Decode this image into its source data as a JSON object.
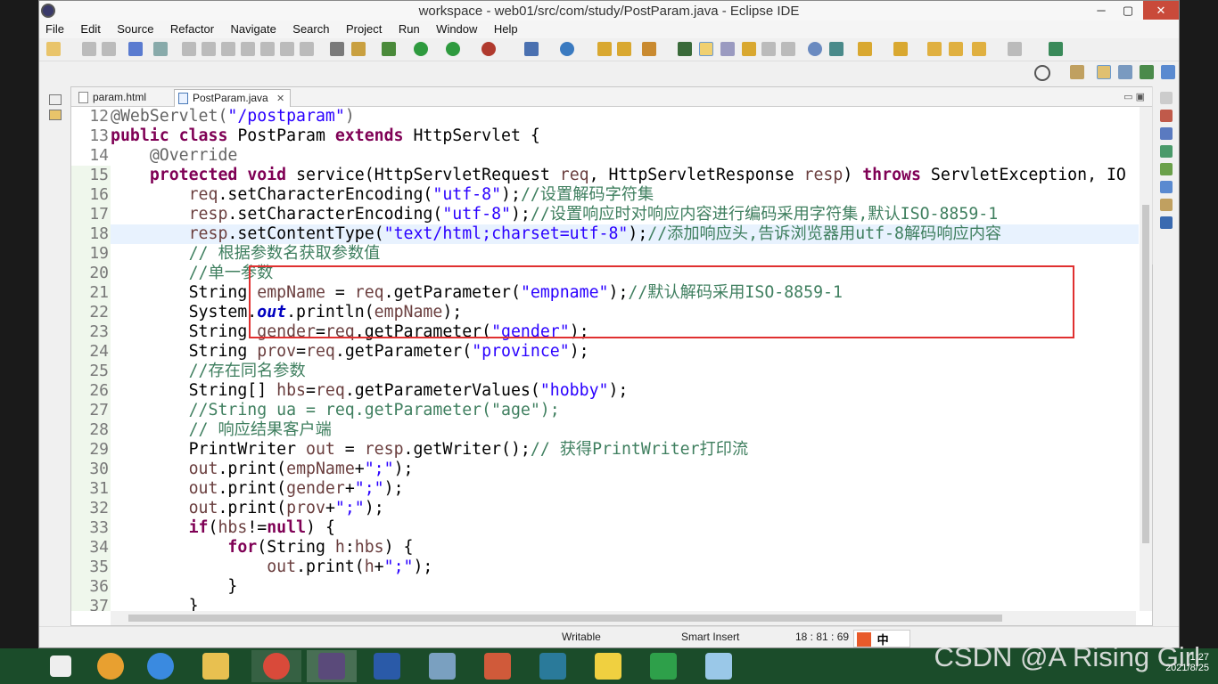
{
  "window": {
    "title": "workspace - web01/src/com/study/PostParam.java - Eclipse IDE",
    "minimize": "─",
    "maximize": "▢",
    "close": "✕"
  },
  "menu": [
    "File",
    "Edit",
    "Source",
    "Refactor",
    "Navigate",
    "Search",
    "Project",
    "Run",
    "Window",
    "Help"
  ],
  "tabs": [
    {
      "label": "param.html",
      "icon": "html-file-icon"
    },
    {
      "label": "PostParam.java",
      "icon": "java-file-icon",
      "active": true,
      "close": "✕"
    }
  ],
  "code_lines": [
    {
      "num": "12",
      "html": "<span class=\"ann\">@WebServlet(</span><span class=\"str\">\"/postparam\"</span><span class=\"ann\">)</span>"
    },
    {
      "num": "13",
      "html": "<span class=\"kw\">public</span> <span class=\"kw\">class</span> PostParam <span class=\"kw\">extends</span> HttpServlet {"
    },
    {
      "num": "14",
      "html": "    <span class=\"ann\">@Override</span>"
    },
    {
      "num": "15",
      "mark": true,
      "html": "    <span class=\"kw\">protected</span> <span class=\"kw\">void</span> service(HttpServletRequest <span class=\"var\">req</span>, HttpServletResponse <span class=\"var\">resp</span>) <span class=\"kw\">throws</span> ServletException, IO"
    },
    {
      "num": "16",
      "mark": true,
      "html": "        <span class=\"var\">req</span>.setCharacterEncoding(<span class=\"str\">\"utf-8\"</span>);<span class=\"cm\">//设置解码字符集</span>"
    },
    {
      "num": "17",
      "mark": true,
      "html": "        <span class=\"var\">resp</span>.setCharacterEncoding(<span class=\"str\">\"utf-8\"</span>);<span class=\"cm\">//设置响应时对响应内容进行编码采用字符集,默认ISO-8859-1</span>"
    },
    {
      "num": "18",
      "mark": true,
      "cur": true,
      "html": "        <span class=\"var\">resp</span>.setContentType(<span class=\"str\">\"text/html;charset=utf-8\"</span>);<span class=\"cm\">//添加响应头,告诉浏览器用utf-8解码响应内容</span>"
    },
    {
      "num": "19",
      "mark": true,
      "html": "        <span class=\"cm\">// 根据参数名获取参数值</span>"
    },
    {
      "num": "20",
      "mark": true,
      "html": "        <span class=\"cm\">//单一参数</span>"
    },
    {
      "num": "21",
      "mark": true,
      "html": "        String <span class=\"var\">empName</span> = <span class=\"var\">req</span>.getParameter(<span class=\"str\">\"empname\"</span>);<span class=\"cm\">//默认解码采用ISO-8859-1</span>"
    },
    {
      "num": "22",
      "mark": true,
      "html": "        System.<span class=\"fld\">out</span>.println(<span class=\"var\">empName</span>);"
    },
    {
      "num": "23",
      "mark": true,
      "html": "        String <span class=\"var\">gender</span>=<span class=\"var\">req</span>.getParameter(<span class=\"str\">\"gender\"</span>);"
    },
    {
      "num": "24",
      "mark": true,
      "html": "        String <span class=\"var\">prov</span>=<span class=\"var\">req</span>.getParameter(<span class=\"str\">\"province\"</span>);"
    },
    {
      "num": "25",
      "mark": true,
      "html": "        <span class=\"cm\">//存在同名参数</span>"
    },
    {
      "num": "26",
      "mark": true,
      "html": "        String[] <span class=\"var\">hbs</span>=<span class=\"var\">req</span>.getParameterValues(<span class=\"str\">\"hobby\"</span>);"
    },
    {
      "num": "27",
      "mark": true,
      "html": "        <span class=\"cm\">//String ua = req.getParameter(\"age\");</span>"
    },
    {
      "num": "28",
      "mark": true,
      "html": "        <span class=\"cm\">// 响应结果客户端</span>"
    },
    {
      "num": "29",
      "mark": true,
      "html": "        PrintWriter <span class=\"var\">out</span> = <span class=\"var\">resp</span>.getWriter();<span class=\"cm\">// 获得PrintWriter打印流</span>"
    },
    {
      "num": "30",
      "mark": true,
      "html": "        <span class=\"var\">out</span>.print(<span class=\"var\">empName</span>+<span class=\"str\">\";\"</span>);"
    },
    {
      "num": "31",
      "mark": true,
      "html": "        <span class=\"var\">out</span>.print(<span class=\"var\">gender</span>+<span class=\"str\">\";\"</span>);"
    },
    {
      "num": "32",
      "mark": true,
      "html": "        <span class=\"var\">out</span>.print(<span class=\"var\">prov</span>+<span class=\"str\">\";\"</span>);"
    },
    {
      "num": "33",
      "mark": true,
      "html": "        <span class=\"kw\">if</span>(<span class=\"var\">hbs</span>!=<span class=\"kw\">null</span>) {"
    },
    {
      "num": "34",
      "mark": true,
      "html": "            <span class=\"kw\">for</span>(String <span class=\"var\">h</span>:<span class=\"var\">hbs</span>) {"
    },
    {
      "num": "35",
      "mark": true,
      "html": "                <span class=\"var\">out</span>.print(<span class=\"var\">h</span>+<span class=\"str\">\";\"</span>);"
    },
    {
      "num": "36",
      "mark": true,
      "html": "            }"
    },
    {
      "num": "37",
      "mark": true,
      "html": "        }"
    }
  ],
  "status": {
    "writable": "Writable",
    "insert_mode": "Smart Insert",
    "position": "18 : 81 : 69"
  },
  "ime": {
    "label": "中"
  },
  "taskbar": {
    "apps": [
      "start-icon",
      "360-icon",
      "ie-icon",
      "explorer-icon",
      "chrome-icon",
      "eclipse-icon",
      "word-icon",
      "remote-icon",
      "ppt-icon",
      "visio-icon",
      "help-icon",
      "hbuilder-icon",
      "notepad-icon"
    ],
    "time": "1:27",
    "date": "2021/8/25"
  },
  "watermark": "CSDN @A Rising Girl",
  "colors": {
    "highlight_box": "#e03030",
    "keyword": "#7f0055",
    "string": "#2a00ff",
    "comment": "#3f7f5f",
    "taskbar": "#1b4c2a"
  }
}
